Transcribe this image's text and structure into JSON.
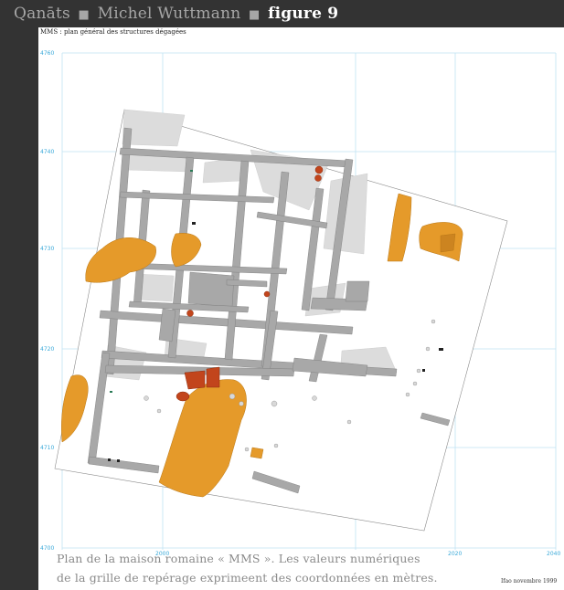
{
  "header": {
    "part1": "Qanāts",
    "separator": "■",
    "part2": "Michel Wuttmann",
    "part3": "figure 9"
  },
  "plan_subtitle": "MMS : plan général des structures dégagées",
  "grid": {
    "y_ticks": [
      "4760",
      "4740",
      "4730",
      "4720",
      "4710",
      "4700"
    ],
    "x_ticks": [
      "2000",
      "2020",
      "2040"
    ]
  },
  "caption": {
    "line1": "Plan de la maison romaine « MMS ». Les valeurs numériques",
    "line2": "de la grille de repérage exprimeent des coordonnées en mètres."
  },
  "date_note": "Ifao novembre 1999",
  "colors": {
    "header_bg": "#333333",
    "grid_line": "#bfe3f3",
    "wall": "#a8a8a8",
    "floor": "#dcdcdc",
    "orange_zone": "#e59a2a",
    "red_feature": "#c2451c"
  }
}
